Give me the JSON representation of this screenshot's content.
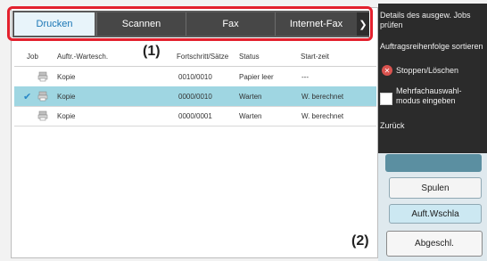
{
  "tabs": [
    {
      "label": "Drucken",
      "active": true
    },
    {
      "label": "Scannen",
      "active": false
    },
    {
      "label": "Fax",
      "active": false
    },
    {
      "label": "Internet-Fax",
      "active": false
    }
  ],
  "callouts": {
    "tabs": "(1)",
    "done": "(2)"
  },
  "columns": {
    "job": "Job",
    "queue": "Auftr.-Wartesch.",
    "progress": "Fortschritt/Sätze",
    "status": "Status",
    "start": "Start-zeit"
  },
  "rows": [
    {
      "name": "Kopie",
      "progress": "0010/0010",
      "status": "Papier leer",
      "start": "---",
      "selected": false
    },
    {
      "name": "Kopie",
      "progress": "0000/0010",
      "status": "Warten",
      "start": "W. berechnet",
      "selected": true
    },
    {
      "name": "Kopie",
      "progress": "0000/0001",
      "status": "Warten",
      "start": "W. berechnet",
      "selected": false
    }
  ],
  "menu": {
    "details": "Details des ausgew. Jobs prüfen",
    "order": "Auftragsreihenfolge sortieren",
    "stop": "Stoppen/Löschen",
    "multi": "Mehrfachauswahl-modus eingeben",
    "back": "Zurück"
  },
  "buttons": {
    "spool": "Spulen",
    "queue": "Auft.Wschla",
    "done": "Abgeschl."
  },
  "colors": {
    "tab_active_text": "#1a76b5",
    "highlight": "#e3202d",
    "selected_row": "#9fd6e2",
    "panel_bg": "#2b2b2b"
  },
  "icons": {
    "job_icon": "printer-job-icon",
    "checkmark": "checkmark-icon",
    "stop": "stop-icon",
    "tab_arrow": "chevron-right-icon"
  }
}
